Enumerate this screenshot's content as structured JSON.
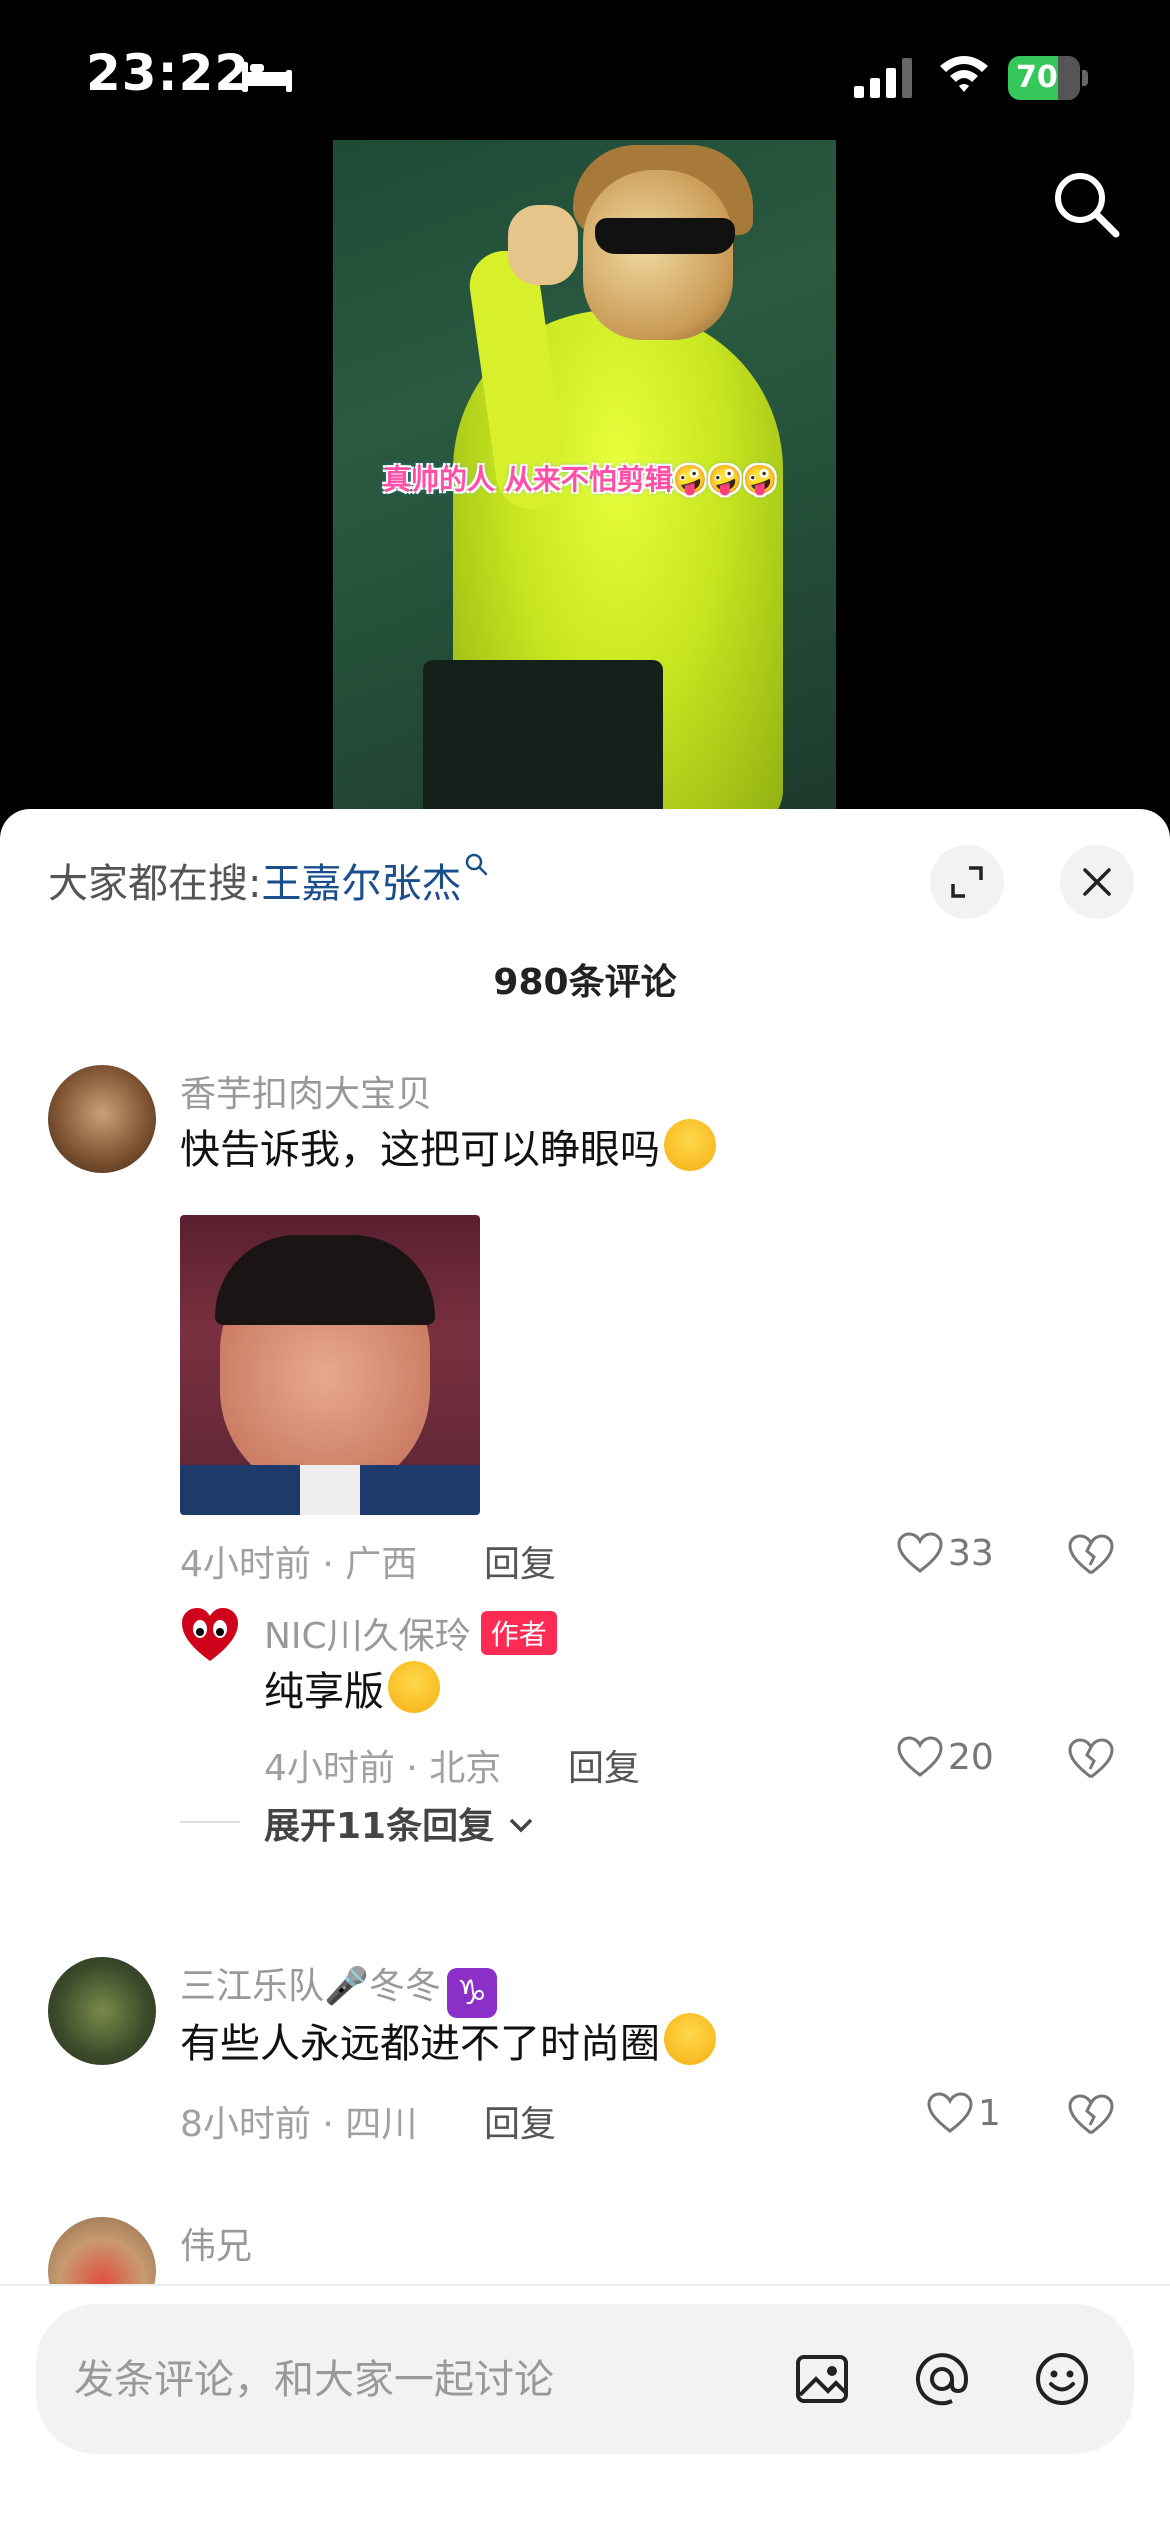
{
  "status_bar": {
    "time": "23:22",
    "battery": "70"
  },
  "video": {
    "caption": "真帅的人 从来不怕剪辑🤪🤪🤪"
  },
  "sheet": {
    "trending_prefix": "大家都在搜:",
    "trending_term": "王嘉尔张杰",
    "comment_count": "980条评论"
  },
  "comments": [
    {
      "username": "香芋扣肉大宝贝",
      "text": "快告诉我，这把可以睁眼吗",
      "meta": "4小时前 · 广西",
      "reply": "回复",
      "likes": "33"
    },
    {
      "username": "NIC川久保玲",
      "badge": "作者",
      "text": "纯享版",
      "meta": "4小时前 · 北京",
      "reply": "回复",
      "likes": "20"
    },
    {
      "username": "三江乐队🎤冬冬",
      "text": "有些人永远都进不了时尚圈",
      "meta": "8小时前 · 四川",
      "reply": "回复",
      "likes": "1"
    },
    {
      "username": "伟兄"
    }
  ],
  "expand_replies": "展开11条回复",
  "input": {
    "placeholder": "发条评论，和大家一起讨论"
  },
  "colors": {
    "accent": "#fe2c55",
    "link": "#1a4f8b",
    "battery": "#35c759"
  }
}
